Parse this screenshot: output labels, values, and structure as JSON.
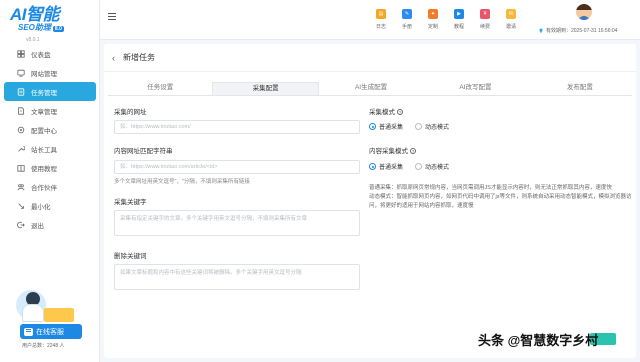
{
  "app": {
    "logo_text": "AI智能",
    "logo_sub": "SEO助理",
    "logo_badge": "8.0",
    "version": "v8.0.1"
  },
  "sidebar": {
    "items": [
      {
        "label": "仪表盘",
        "icon": "dashboard-icon"
      },
      {
        "label": "网站管理",
        "icon": "website-icon"
      },
      {
        "label": "任务管理",
        "icon": "task-icon",
        "active": true
      },
      {
        "label": "文章管理",
        "icon": "article-icon"
      },
      {
        "label": "配置中心",
        "icon": "config-icon"
      },
      {
        "label": "站长工具",
        "icon": "tool-icon"
      },
      {
        "label": "使用教程",
        "icon": "tutorial-icon"
      },
      {
        "label": "合作伙伴",
        "icon": "partner-icon"
      },
      {
        "label": "最小化",
        "icon": "minimize-icon"
      },
      {
        "label": "退出",
        "icon": "logout-icon"
      }
    ],
    "service_button": "在线客服",
    "user_count": "用户总数：2248 人"
  },
  "topbar": {
    "tools": [
      {
        "label": "日志",
        "color": "#f5a623"
      },
      {
        "label": "手册",
        "color": "#2d8cf0"
      },
      {
        "label": "定制",
        "color": "#f27c2a"
      },
      {
        "label": "教程",
        "color": "#1e88e5"
      },
      {
        "label": "续费",
        "color": "#e8566c"
      },
      {
        "label": "邀请",
        "color": "#f6b93b"
      }
    ],
    "expire_text": "有效期到：2025-07-31 16:56:04"
  },
  "page": {
    "title": "新增任务",
    "tabs": [
      "任务设置",
      "采集配置",
      "AI生成配置",
      "AI改写配置",
      "发布配置"
    ],
    "active_tab": 1
  },
  "form": {
    "collect_url": {
      "label": "采集的网址",
      "placeholder": "如：https://www.toutiao.com/"
    },
    "content_url_match": {
      "label": "内容网址匹配字符串",
      "placeholder": "如：https://www.toutiao.com/article/<id>",
      "hint": "多个文章网址用英文逗号\"，\"分隔，不填则采集所有链接"
    },
    "collect_keywords": {
      "label": "采集关键字",
      "placeholder": "采集有指定关键字的文章。多个关键字用英文逗号分隔，不填则采集所有文章"
    },
    "delete_keywords": {
      "label": "删除关键词",
      "placeholder": "如果文章标题和内容中有这些关键词将被删除。多个关键字用英文逗号分隔"
    },
    "collect_mode": {
      "label": "采集模式",
      "options": [
        "普通采集",
        "动态模式"
      ],
      "selected": 0
    },
    "content_mode": {
      "label": "内容采集模式",
      "options": [
        "普通采集",
        "动态模式"
      ],
      "selected": 0
    },
    "mode_desc": [
      "普通采集：抓取原网页常规内容，当网页需调用JS才能显示内容时，则无法正常抓取其内容，速度快",
      "动态模式：智能抓取网页内容，如网页代码中调用了js等文件，则系统自动采用动态智能模式，模拟浏览器访问，将更好的适用于网站内容抓取，速度慢"
    ]
  },
  "watermark": {
    "text": "头条 @智慧数字乡村"
  }
}
